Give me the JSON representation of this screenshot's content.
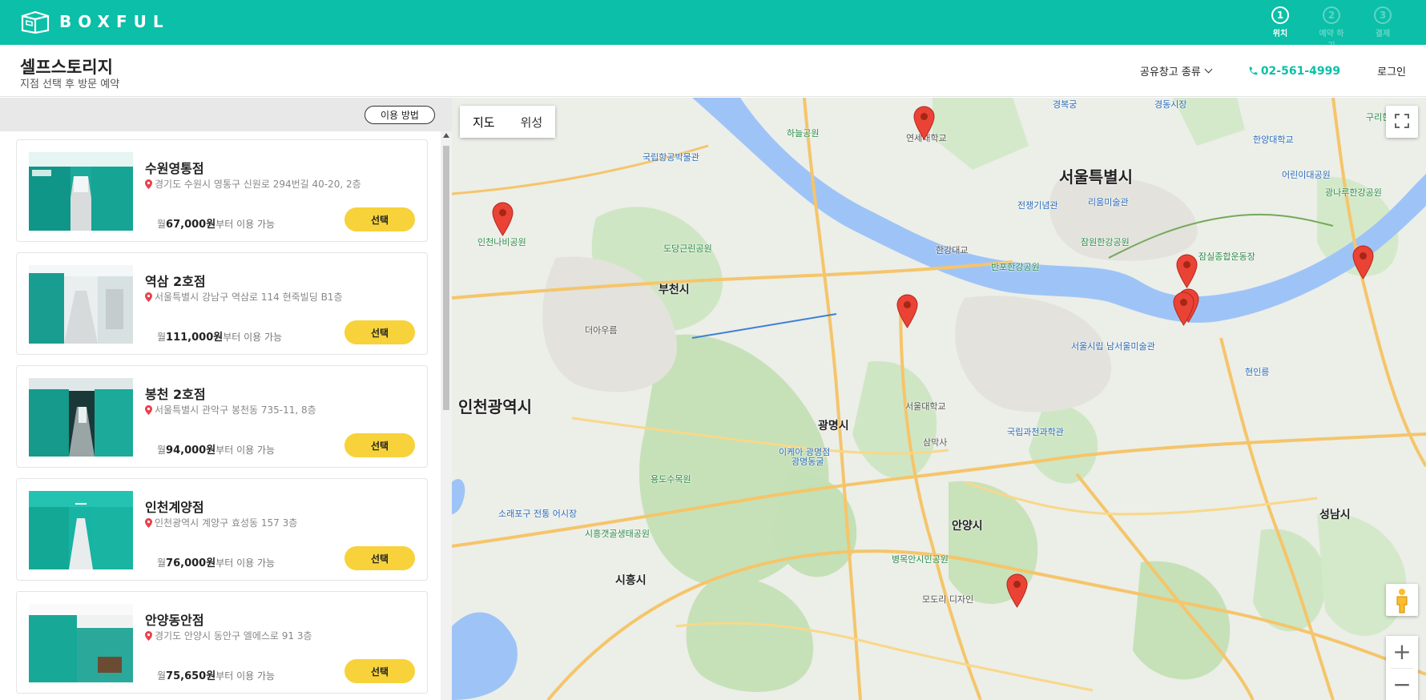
{
  "header": {
    "logo_text": "BOXFUL",
    "steps": [
      {
        "num": "1",
        "label": "위치",
        "active": true
      },
      {
        "num": "2",
        "label": "예약 하기",
        "active": false
      },
      {
        "num": "3",
        "label": "결제",
        "active": false
      }
    ]
  },
  "subheader": {
    "title": "셀프스토리지",
    "subtitle": "지점 선택 후 방문 예약",
    "nav_type": "공유창고 종류",
    "phone": "02-561-4999",
    "login": "로그인"
  },
  "left_panel": {
    "howto_label": "이용 방법",
    "price_prefix": "월",
    "price_suffix": "부터 이용 가능",
    "select_label": "선택",
    "stores": [
      {
        "name": "수원영통점",
        "address": "경기도 수원시 영통구 신원로 294번길 40-20, 2층",
        "price": "67,000원"
      },
      {
        "name": "역삼 2호점",
        "address": "서울특별시 강남구 역삼로 114 현죽빌딩 B1층",
        "price": "111,000원"
      },
      {
        "name": "봉천 2호점",
        "address": "서울특별시 관악구 봉천동 735-11, 8층",
        "price": "94,000원"
      },
      {
        "name": "인천계양점",
        "address": "인천광역시 계양구 효성동 157 3층",
        "price": "76,000원"
      },
      {
        "name": "안양동안점",
        "address": "경기도 안양시 동안구 엘에스로 91 3층",
        "price": "75,650원"
      }
    ]
  },
  "map": {
    "type_map": "지도",
    "type_satellite": "위성",
    "labels": {
      "seoul": "서울특별시",
      "incheon": "인천광역시",
      "bucheon": "부천시",
      "gwangmyeong": "광명시",
      "anyang": "안양시",
      "siheung": "시흥시",
      "seongnam": "성남시",
      "gyeongbokgung": "경복궁",
      "gyeongdong": "경동시장",
      "yonsei": "연세대학교",
      "gimpo": "국립항공박물관",
      "haneul": "하늘공원",
      "war_memorial": "전쟁기념관",
      "leeum": "리움미술관",
      "children_park": "어린이대공원",
      "jamwon": "잠원한강공원",
      "banpo": "반포한강공원",
      "jamsil": "잠실종합운동장",
      "gwangnaru": "광나루한강공원",
      "incheon_butterfly": "인천나비공원",
      "dodang": "도당근린공원",
      "snu": "서울대학교",
      "seoul_museum": "서울시립 남서울미술관",
      "gwacheon": "국립과천과학관",
      "ikea": "이케아 광명점",
      "gwangmyeong_cave": "광명동굴",
      "yongdo": "용도수목원",
      "siheung_eco": "시흥갯골생태공원",
      "sorae": "소래포구 전통 어시장",
      "byeongmok": "병목안시민공원",
      "hanyang": "한양대학교",
      "hyeonilyeong": "현인릉",
      "samaksa": "삼막사",
      "modori": "모도리 디자인",
      "deoaum": "더아우름",
      "guri": "구리한강공원",
      "hanggang": "한강대교"
    }
  }
}
